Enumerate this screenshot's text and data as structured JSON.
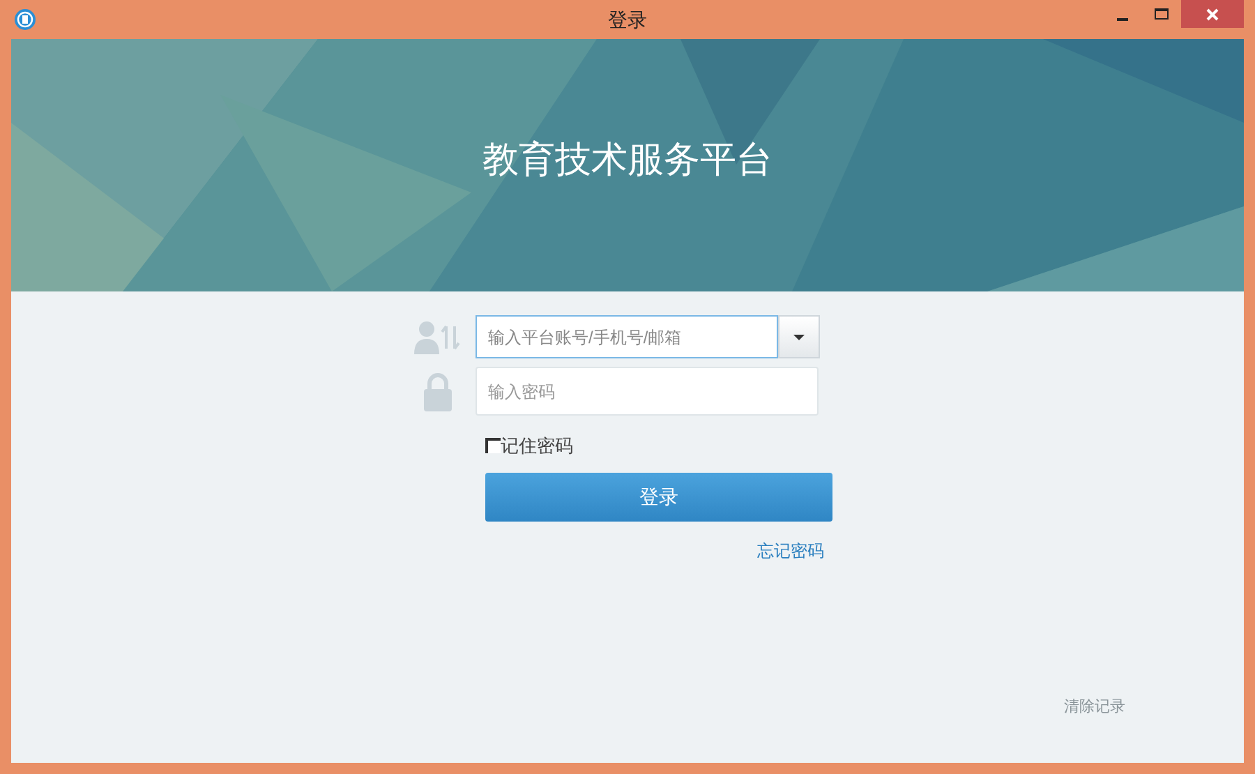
{
  "window": {
    "title": "登录"
  },
  "banner": {
    "title": "教育技术服务平台"
  },
  "login": {
    "account": {
      "placeholder": "输入平台账号/手机号/邮箱",
      "focused": true
    },
    "password": {
      "placeholder": "输入密码"
    },
    "remember": {
      "label": "记住密码",
      "checked": false
    },
    "submit": "登录",
    "forgot": "忘记密码"
  },
  "clear_history": "清除记录"
}
